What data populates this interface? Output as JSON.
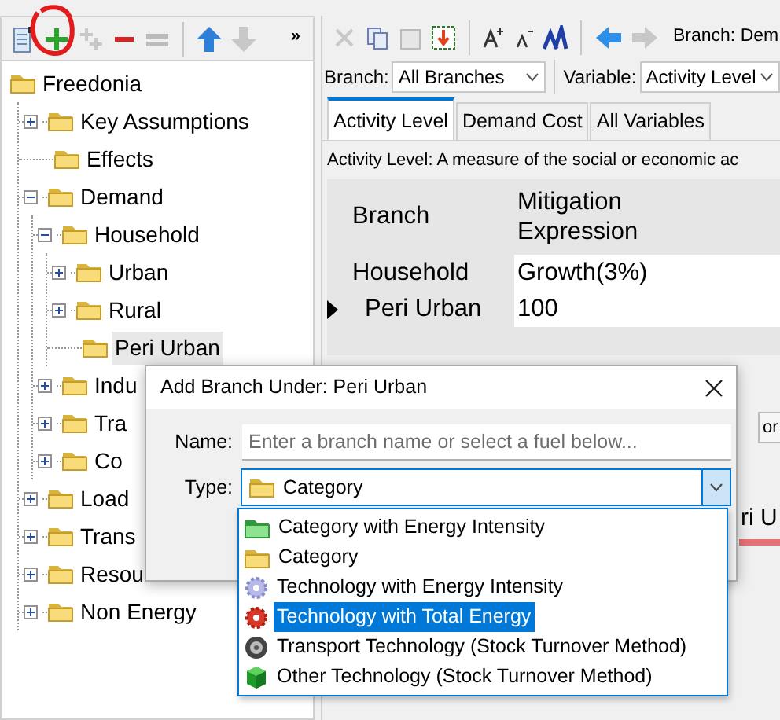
{
  "tree_toolbar": {
    "overflow": "»"
  },
  "tree": [
    {
      "label": "Freedonia",
      "selected": false,
      "children": [
        {
          "label": "Key Assumptions",
          "expanded": false,
          "selected": false
        },
        {
          "label": "Effects",
          "selected": false
        },
        {
          "label": "Demand",
          "expanded": true,
          "selected": false,
          "children": [
            {
              "label": "Household",
              "expanded": true,
              "selected": false,
              "children": [
                {
                  "label": "Urban",
                  "expanded": false,
                  "selected": false
                },
                {
                  "label": "Rural",
                  "expanded": false,
                  "selected": false
                },
                {
                  "label": "Peri Urban",
                  "selected": true
                }
              ]
            },
            {
              "label": "Indu",
              "expanded": false,
              "selected": false
            },
            {
              "label": "Tra",
              "expanded": false,
              "selected": false
            },
            {
              "label": "Co",
              "expanded": false,
              "selected": false
            }
          ]
        },
        {
          "label": "Load",
          "expanded": false,
          "selected": false
        },
        {
          "label": "Trans",
          "expanded": false,
          "selected": false
        },
        {
          "label": "Resou",
          "expanded": false,
          "selected": false
        },
        {
          "label": "Non Energy",
          "expanded": false,
          "selected": false
        }
      ]
    }
  ],
  "breadcrumb": "Branch: Dem",
  "branch_select": {
    "label": "Branch:",
    "value": "All Branches"
  },
  "variable_select": {
    "label": "Variable:",
    "value": "Activity Level"
  },
  "tabs": [
    {
      "label": "Activity Level",
      "selected": true
    },
    {
      "label": "Demand Cost",
      "selected": false
    },
    {
      "label": "All Variables",
      "selected": false
    }
  ],
  "description": "Activity Level: A measure of the social or economic ac",
  "table": {
    "columns": [
      "Branch",
      "Mitigation Expression"
    ],
    "rows": [
      {
        "branch": "Household",
        "expression": "Growth(3%)",
        "current": false,
        "children": [
          {
            "branch": "Peri Urban",
            "expression": "100",
            "current": true
          }
        ]
      }
    ]
  },
  "hidden_panel": {
    "tab": "or",
    "heading": "ri U"
  },
  "dialog": {
    "title": "Add Branch Under: Peri Urban",
    "name_label": "Name:",
    "name_placeholder": "Enter a branch name or select a fuel below...",
    "type_label": "Type:",
    "type": {
      "value": "Category",
      "kind": "folder"
    },
    "options": [
      {
        "label": "Category with Energy Intensity",
        "kind": "green-folder",
        "selected": false
      },
      {
        "label": "Category",
        "kind": "folder",
        "selected": false
      },
      {
        "label": "Technology with Energy Intensity",
        "kind": "light-gear",
        "selected": false
      },
      {
        "label": "Technology with Total Energy",
        "kind": "red-gear",
        "selected": true
      },
      {
        "label": "Transport Technology (Stock Turnover Method)",
        "kind": "wheel",
        "selected": false
      },
      {
        "label": "Other Technology (Stock Turnover Method)",
        "kind": "cube",
        "selected": false
      }
    ]
  }
}
